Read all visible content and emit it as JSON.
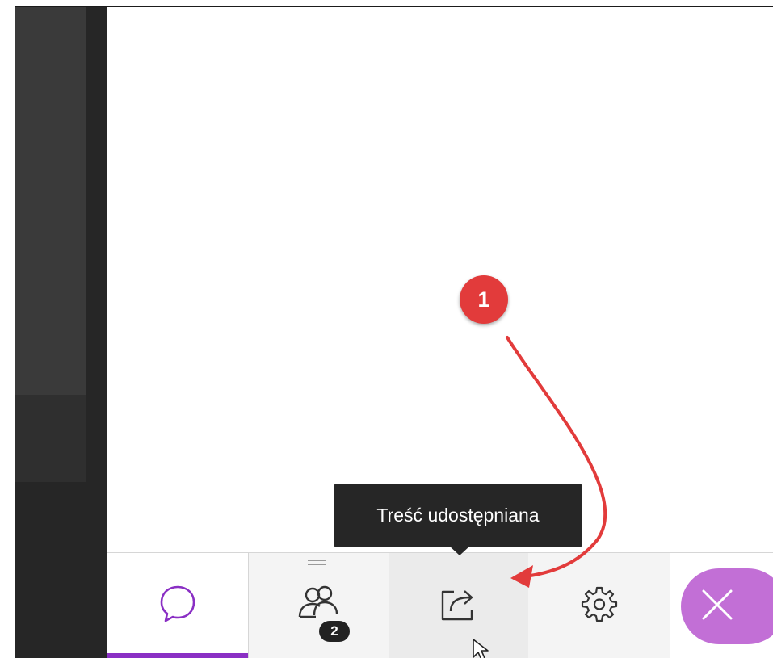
{
  "tooltip": {
    "text": "Treść udostępniana"
  },
  "toolbar": {
    "active_tab": "chat",
    "attendees_count": "2",
    "accent_color": "#8a2fc4",
    "close_color": "#c26fd6"
  },
  "annotation": {
    "step_number": "1",
    "color": "#e23b3b"
  },
  "icons": {
    "chat": "chat-bubble-icon",
    "attendees": "people-icon",
    "share": "share-content-icon",
    "settings": "gear-icon",
    "close": "close-icon"
  }
}
